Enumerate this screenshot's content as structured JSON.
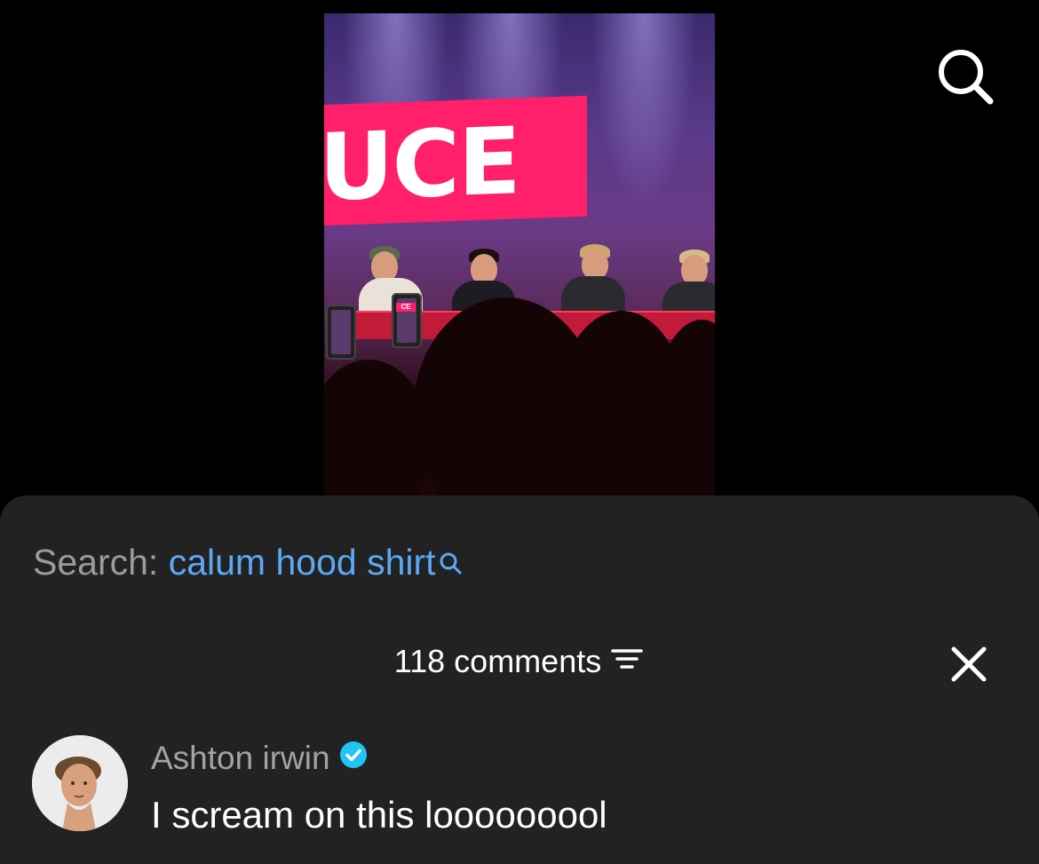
{
  "video": {
    "banner_text": "UCE",
    "phone_tag": "CE"
  },
  "top_icons": [
    "search-icon"
  ],
  "search": {
    "label": "Search:",
    "query": "calum hood shirt",
    "icon": "search-icon"
  },
  "comments": {
    "count_label": "118 comments",
    "filter_icon": "filter-icon",
    "close_icon": "close-icon",
    "items": [
      {
        "username": "Ashton irwin",
        "verified": true,
        "text": "I scream on this looooooool"
      }
    ]
  },
  "colors": {
    "sheet_bg": "#222222",
    "accent_blue": "#5ba8f5",
    "verified_blue": "#20c5f5",
    "banner_pink": "#ff1f6b"
  }
}
